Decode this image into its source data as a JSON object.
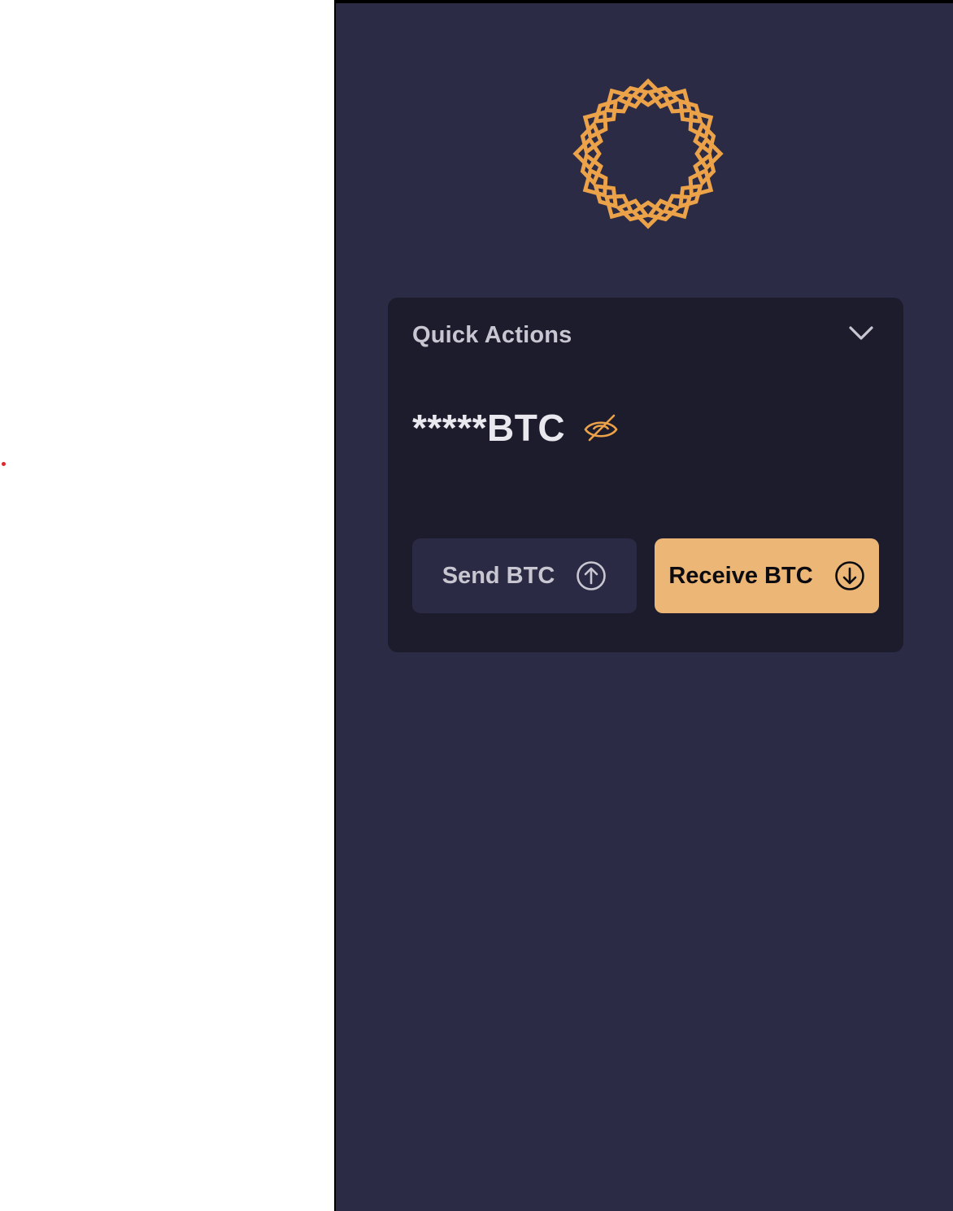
{
  "quick_actions": {
    "title": "Quick Actions",
    "balance": "*****BTC",
    "send_label": "Send BTC",
    "receive_label": "Receive BTC"
  },
  "colors": {
    "panel_bg": "#2c2b46",
    "card_bg": "#1c1c2d",
    "accent": "#eba248",
    "receive_button": "#ebb676",
    "send_button": "#2b2a45"
  },
  "icons": {
    "logo": "star-ring-logo",
    "collapse": "chevron-down-icon",
    "visibility": "eye-off-icon",
    "send": "arrow-up-circle-icon",
    "receive": "arrow-down-circle-icon"
  }
}
